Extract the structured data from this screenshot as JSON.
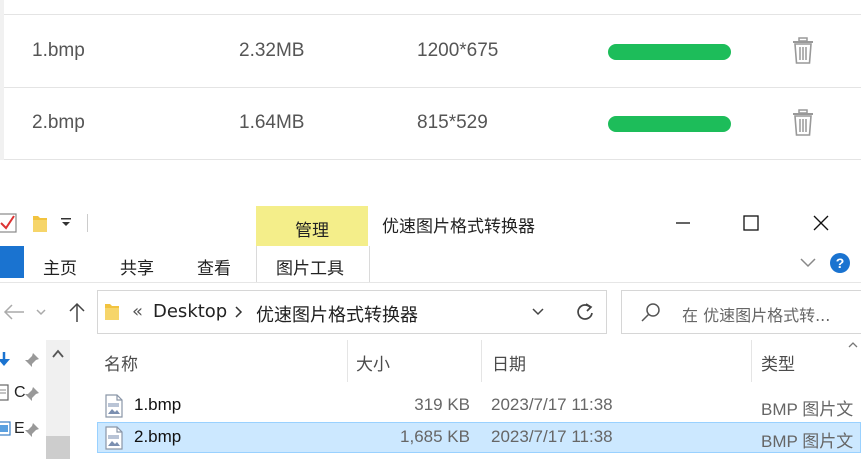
{
  "converter": {
    "files": [
      {
        "name": "1.bmp",
        "size": "2.32MB",
        "dimensions": "1200*675",
        "progress": 1.0
      },
      {
        "name": "2.bmp",
        "size": "1.64MB",
        "dimensions": "815*529",
        "progress": 1.0
      }
    ],
    "progress_color": "#1dbd5a"
  },
  "explorer": {
    "title": "优速图片格式转换器",
    "context_tab": "管理",
    "context_subtab": "图片工具",
    "ribbon_tabs": [
      "主页",
      "共享",
      "查看"
    ],
    "breadcrumb": {
      "prefix": "«",
      "items": [
        "Desktop",
        "优速图片格式转换器"
      ]
    },
    "search_placeholder": "在 优速图片格式转...",
    "columns": [
      "名称",
      "大小",
      "日期",
      "类型"
    ],
    "files": [
      {
        "name": "1.bmp",
        "size": "319 KB",
        "date": "2023/7/17 11:38",
        "type": "BMP 图片文",
        "selected": false
      },
      {
        "name": "2.bmp",
        "size": "1,685 KB",
        "date": "2023/7/17 11:38",
        "type": "BMP 图片文",
        "selected": true
      }
    ],
    "nav_items": [
      "",
      "C",
      "E"
    ],
    "accent": "#1a73d0",
    "context_color": "#f4ee8a"
  }
}
